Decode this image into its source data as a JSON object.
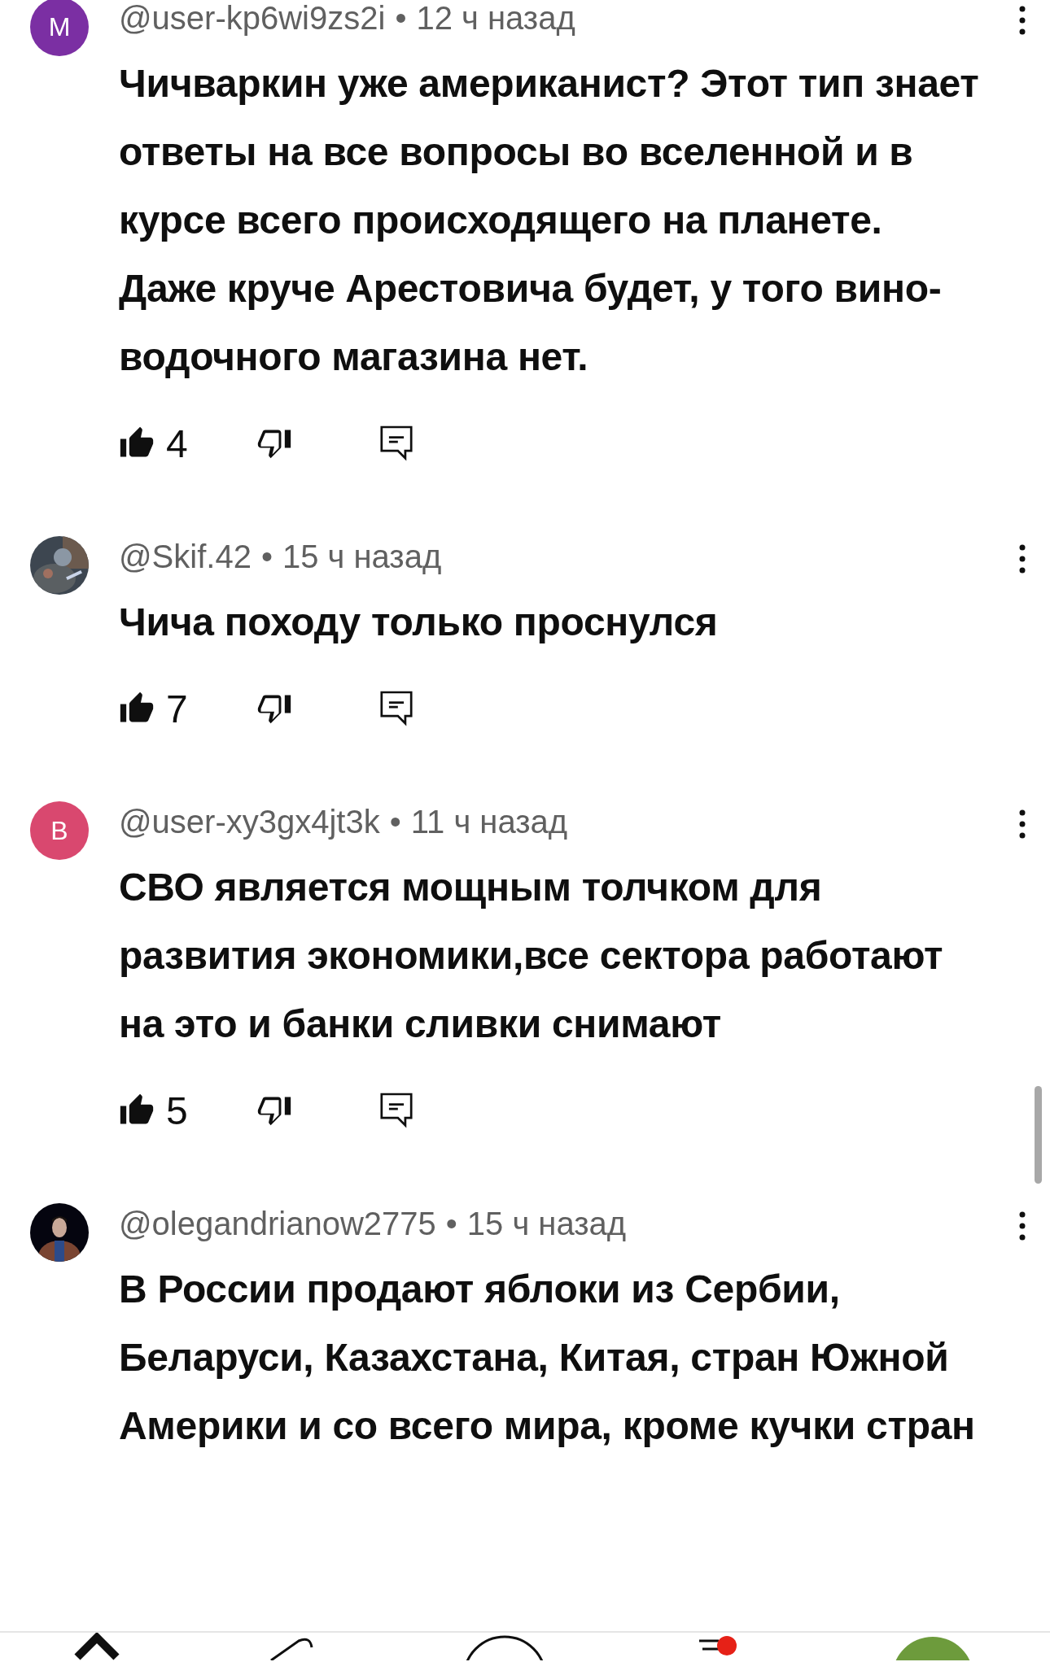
{
  "comments": [
    {
      "avatar": {
        "kind": "letter",
        "letter": "M",
        "color": "#7b2fa3"
      },
      "author": "@user-kp6wi9zs2i",
      "separator": "•",
      "time": "12 ч назад",
      "text": "Чичваркин уже американист? Этот тип знает ответы на все вопросы во вселенной и в курсе всего происходящего на планете. Даже круче Арестовича будет, у того вино-водочного магазина нет.",
      "likes": "4"
    },
    {
      "author": "@Skif.42",
      "separator": "•",
      "time": "15 ч назад",
      "text": "Чича походу только проснулся",
      "likes": "7"
    },
    {
      "avatar": {
        "kind": "letter",
        "letter": "В",
        "color": "#d9486f"
      },
      "author": "@user-xy3gx4jt3k",
      "separator": "•",
      "time": "11 ч назад",
      "text": "СВО является мощным толчком для развития экономики,все сектора работают на это и банки сливки снимают",
      "likes": "5"
    },
    {
      "author": "@olegandrianow2775",
      "separator": "•",
      "time": "15 ч назад",
      "text": "В России продают яблоки из Сербии, Беларуси, Казахстана, Китая, стран Южной Америки и со всего мира, кроме кучки стран"
    }
  ]
}
